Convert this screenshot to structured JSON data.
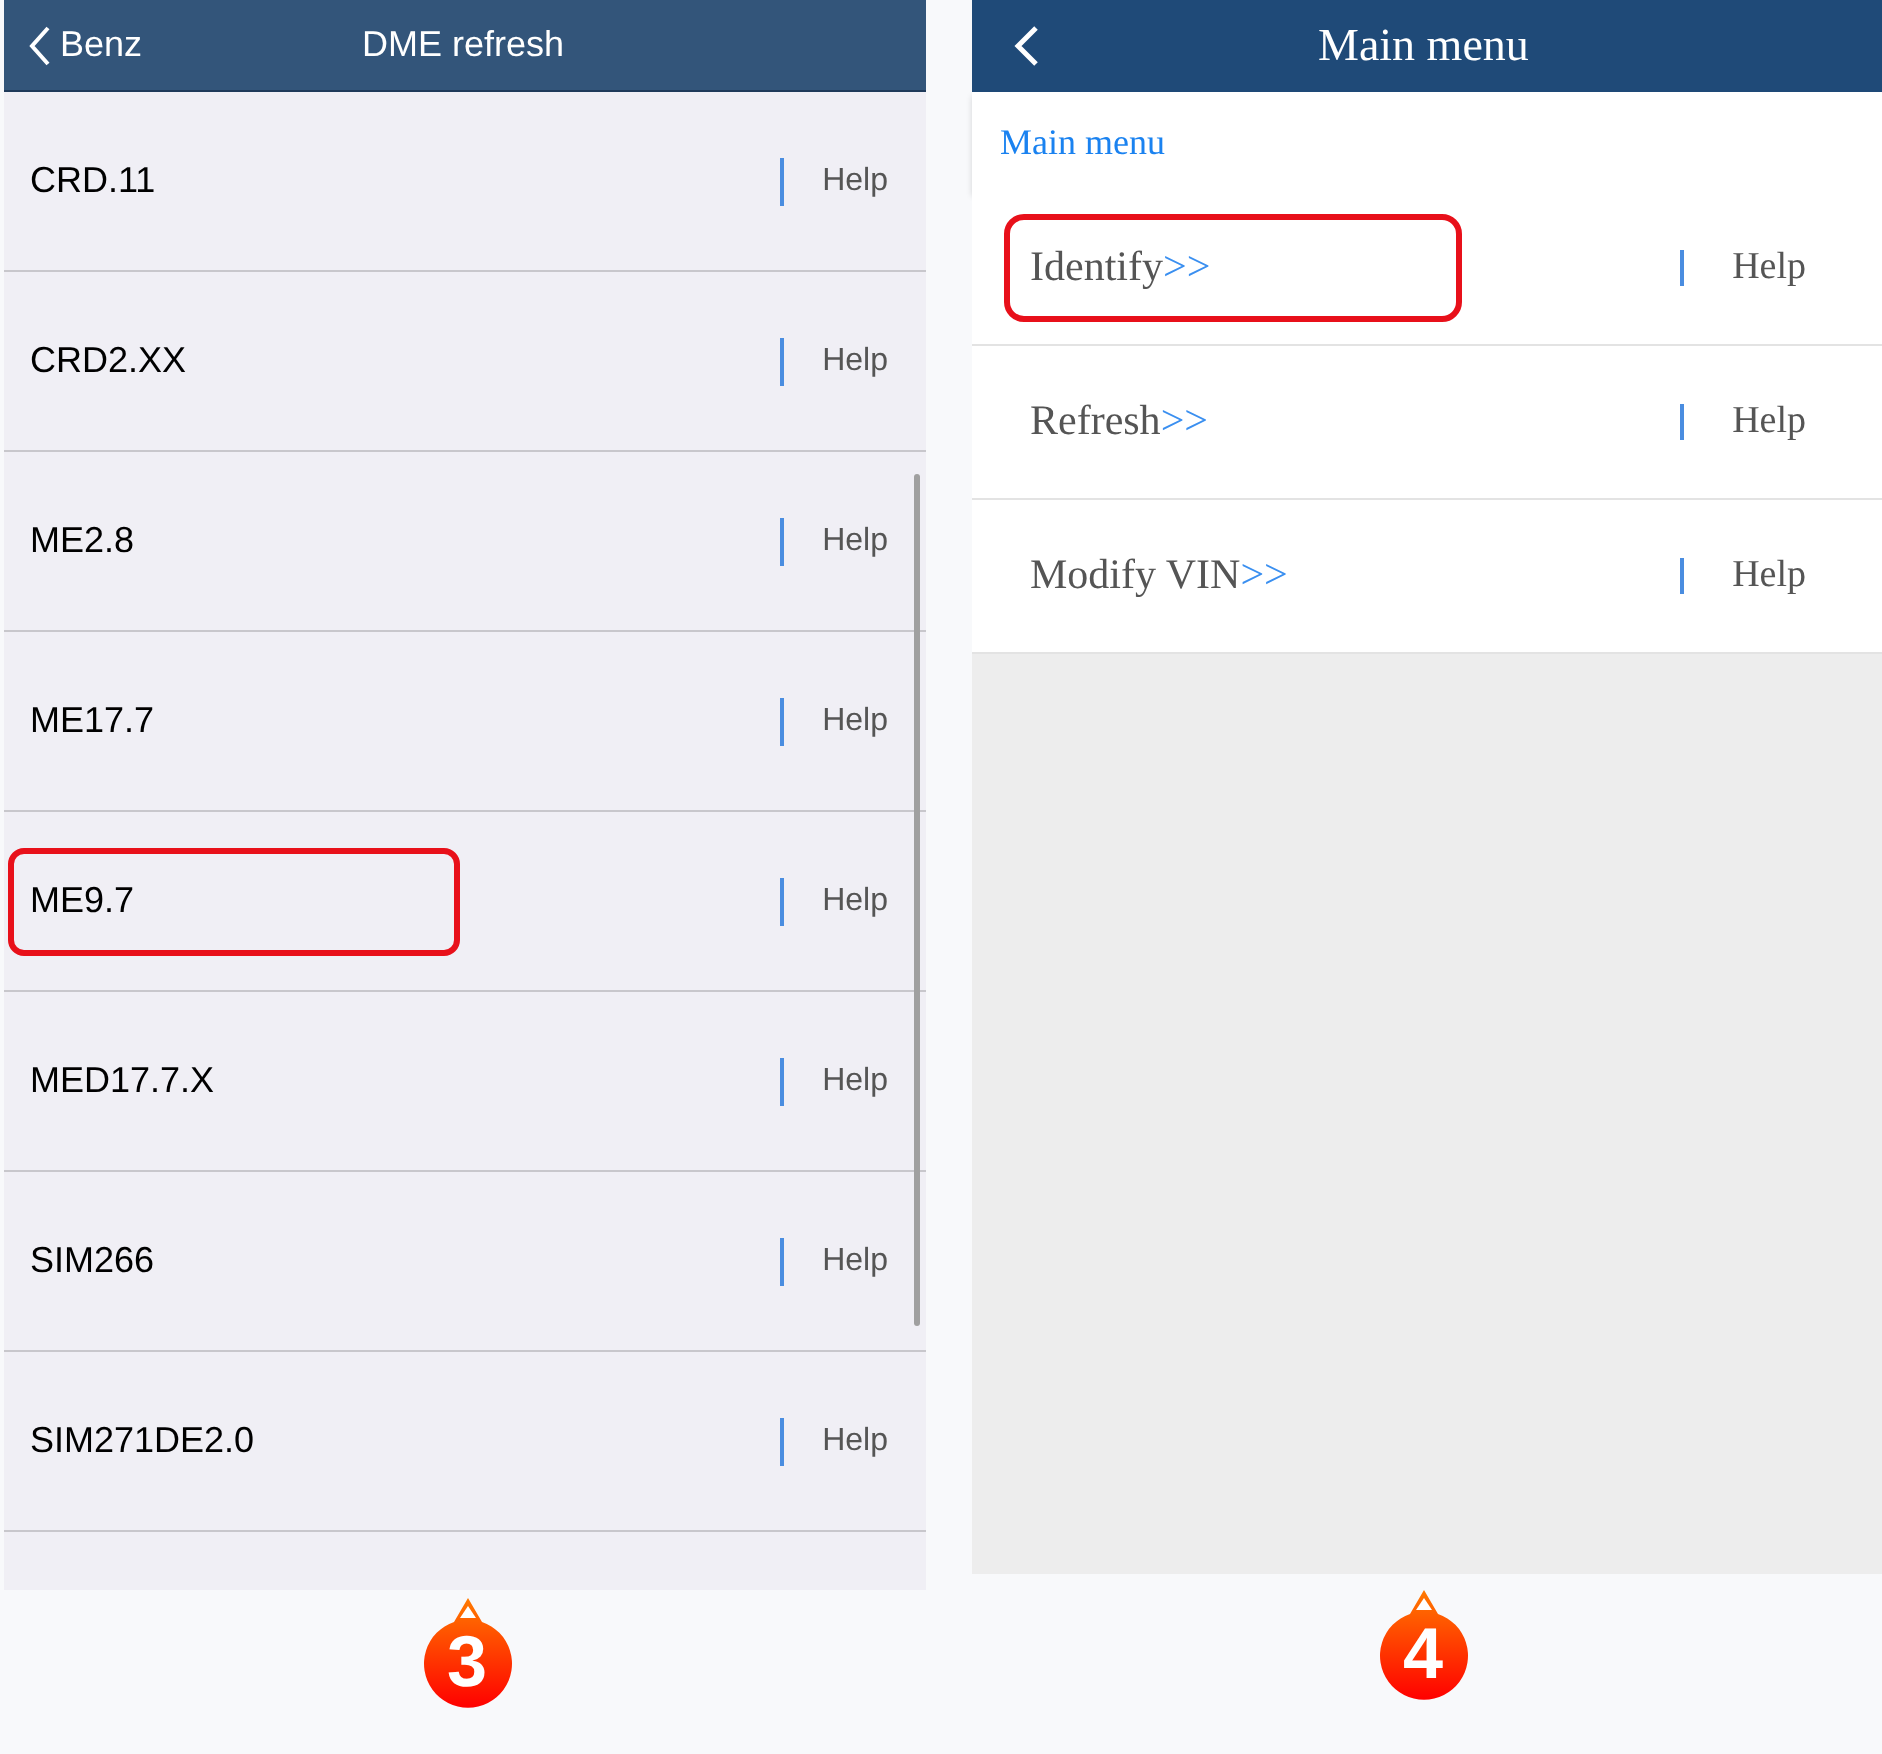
{
  "left_screen": {
    "back_label": "Benz",
    "title": "DME refresh",
    "items": [
      {
        "label": "CRD.11",
        "help": "Help",
        "highlighted": false
      },
      {
        "label": "CRD2.XX",
        "help": "Help",
        "highlighted": false
      },
      {
        "label": "ME2.8",
        "help": "Help",
        "highlighted": false
      },
      {
        "label": "ME17.7",
        "help": "Help",
        "highlighted": false
      },
      {
        "label": "ME9.7",
        "help": "Help",
        "highlighted": true
      },
      {
        "label": "MED17.7.X",
        "help": "Help",
        "highlighted": false
      },
      {
        "label": "SIM266",
        "help": "Help",
        "highlighted": false
      },
      {
        "label": "SIM271DE2.0",
        "help": "Help",
        "highlighted": false
      }
    ],
    "step": "3"
  },
  "right_screen": {
    "title": "Main menu",
    "breadcrumb": "Main menu",
    "items": [
      {
        "label": "Identify",
        "arrow": ">>",
        "help": "Help",
        "highlighted": true
      },
      {
        "label": "Refresh",
        "arrow": ">>",
        "help": "Help",
        "highlighted": false
      },
      {
        "label": "Modify VIN",
        "arrow": ">>",
        "help": "Help",
        "highlighted": false
      }
    ],
    "step": "4"
  }
}
